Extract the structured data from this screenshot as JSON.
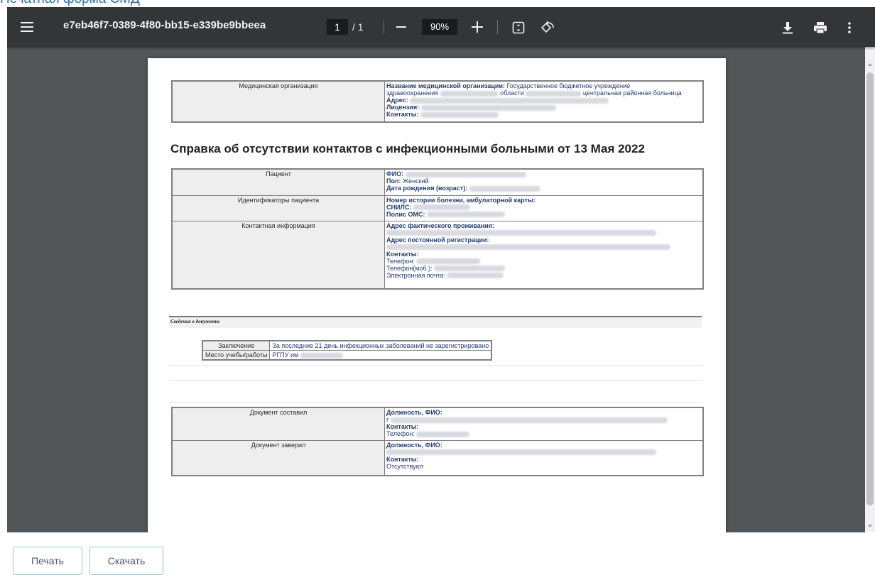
{
  "dialog": {
    "title": "Печатная форма СМД"
  },
  "viewer": {
    "document_title": "e7eb46f7-0389-4f80-bb15-e339be9bbeea",
    "current_page": "1",
    "page_separator": "/ 1",
    "zoom": "90%"
  },
  "icons": {
    "menu": "menu-icon",
    "zoom_out": "minus-icon",
    "zoom_in": "plus-icon",
    "fit": "fit-to-page-icon",
    "rotate": "rotate-icon",
    "download": "download-icon",
    "print": "print-icon",
    "more": "more-vertical-icon"
  },
  "document": {
    "org": {
      "label": "Медицинская организация",
      "name_label": "Название медицинской организации:",
      "name_value_1": "Государственное бюджетное учреждение",
      "name_value_2": "здравоохранения",
      "name_value_3": "области",
      "name_value_4": "центральная районная больница",
      "address_label": "Адрес:",
      "license_label": "Лицензия:",
      "contacts_label": "Контакты:"
    },
    "heading": "Справка об отсутствии контактов с инфекционными больными от 13 Мая 2022",
    "patient": {
      "label": "Пациент",
      "fio_label": "ФИО:",
      "sex_label": "Пол:",
      "sex_value": "Женский",
      "dob_label": "Дата рождения (возраст):"
    },
    "identifiers": {
      "label": "Идентификаторы пациента",
      "history_label": "Номер истории болезни, амбулаторной карты:",
      "snils_label": "СНИЛС:",
      "oms_label": "Полис ОМС:"
    },
    "contact_info": {
      "label": "Контактная информация",
      "actual_address_label": "Адрес фактического проживания:",
      "reg_address_label": "Адрес постоянной регистрации:",
      "contacts_label": "Контакты:",
      "phone_label": "Телефон:",
      "mobile_label": "Телефон(моб.):",
      "email_label": "Электронная почта:"
    },
    "info_section_title": "Сведения о документе",
    "conclusion": {
      "label": "Заключение",
      "value": "За последние 21 день инфекционных заболеваний не зарегистрировано"
    },
    "workplace": {
      "label": "Место учебы/работы",
      "value": "РГПУ им"
    },
    "author": {
      "label": "Документ составил",
      "position_label": "Должность, ФИО:",
      "position_value": "г",
      "contacts_label": "Контакты:",
      "phone_label": "Телефон:"
    },
    "certifier": {
      "label": "Документ заверил",
      "position_label": "Должность, ФИО:",
      "contacts_label": "Контакты:",
      "contacts_value": "Отсутствуют"
    }
  },
  "buttons": {
    "print": "Печать",
    "download": "Скачать"
  }
}
